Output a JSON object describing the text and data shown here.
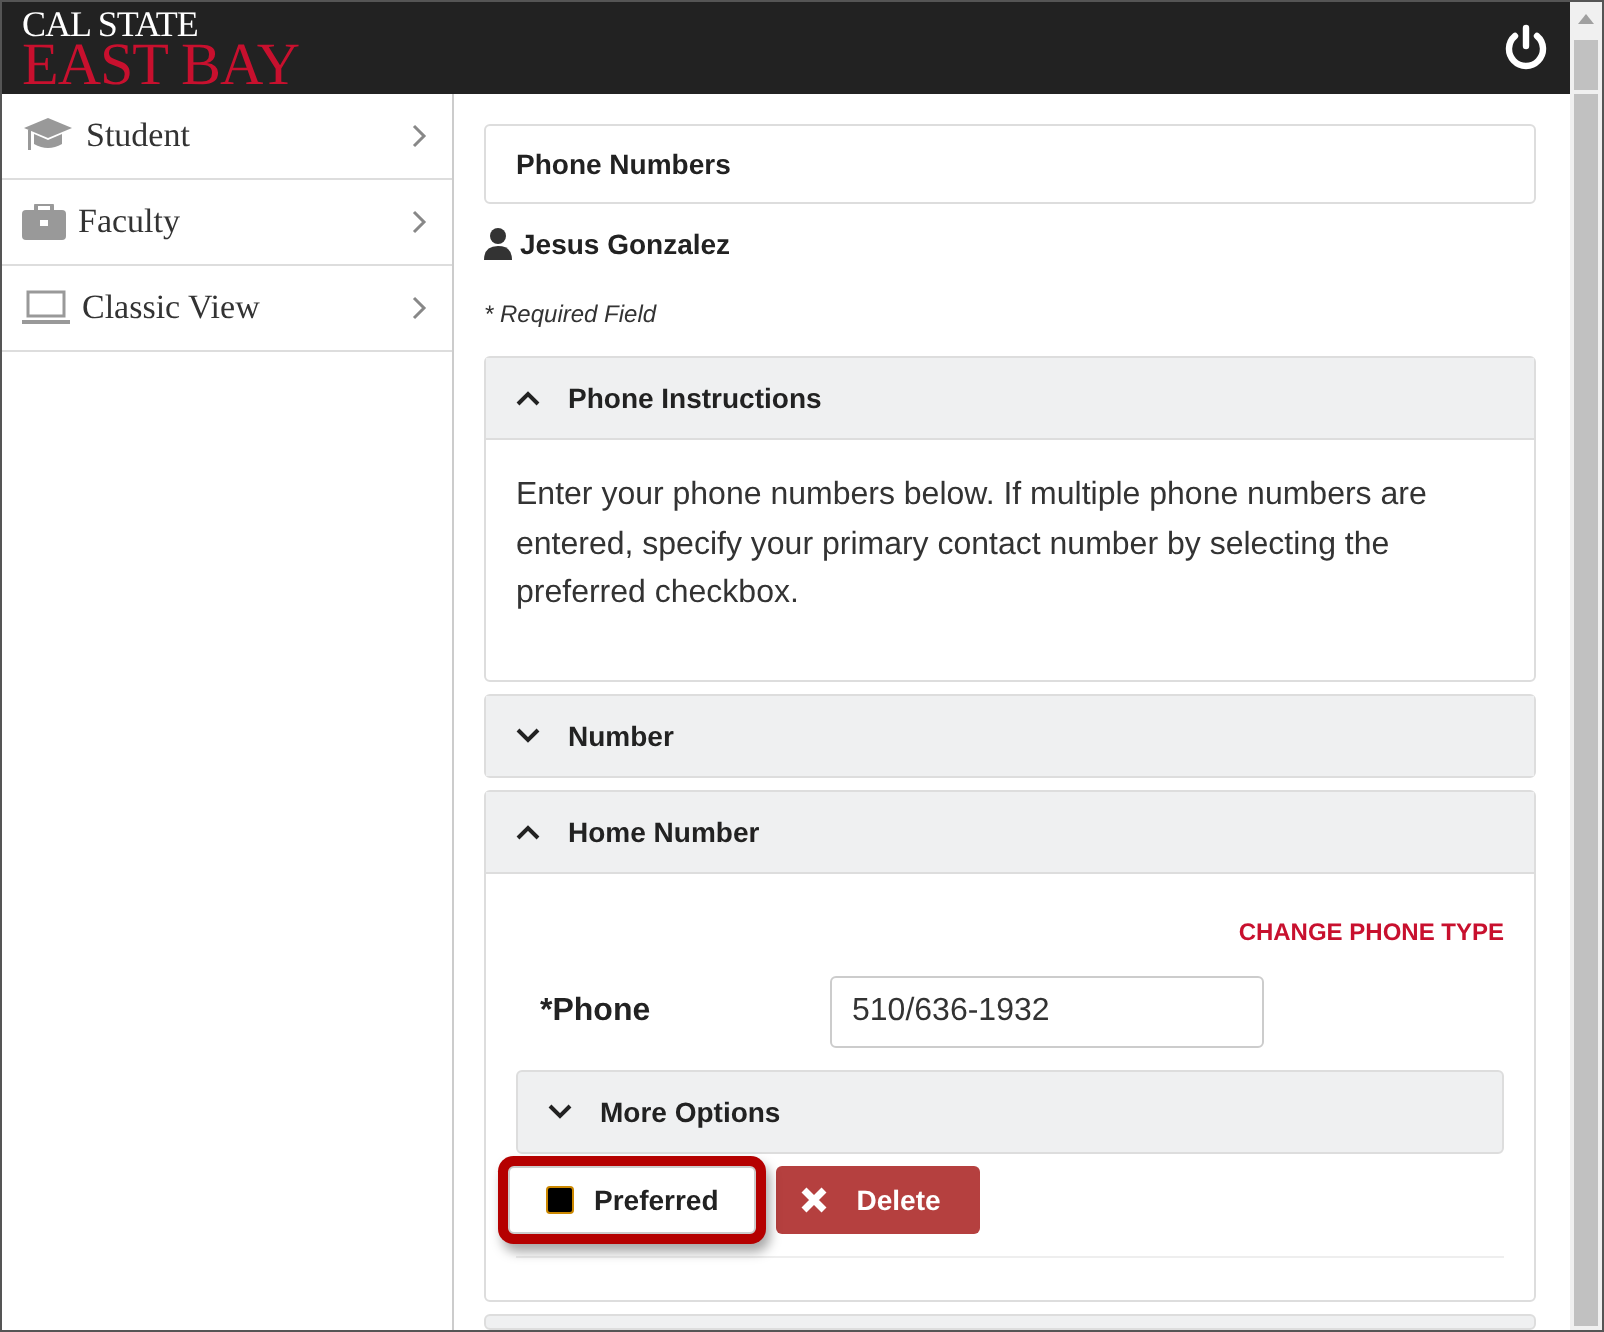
{
  "header": {
    "logo_top": "CAL STATE",
    "logo_bottom": "EAST BAY"
  },
  "sidebar": {
    "items": [
      {
        "label": "Student"
      },
      {
        "label": "Faculty"
      },
      {
        "label": "Classic View"
      }
    ]
  },
  "page_title": "Phone Numbers",
  "user_name": "Jesus Gonzalez",
  "required_note": "* Required Field",
  "sections": [
    {
      "kind": "text",
      "title": "Phone Instructions",
      "expanded": true,
      "body": "Enter your phone numbers below. If multiple phone numbers are entered, specify your primary contact number by selecting the preferred checkbox."
    },
    {
      "title": "Number",
      "expanded": false
    },
    {
      "kind": "phone",
      "title": "Home Number",
      "expanded": true,
      "change_link": "CHANGE PHONE TYPE",
      "field_label": "*Phone",
      "value": "510/636-1932",
      "more_options": {
        "title": "More Options",
        "expanded": false
      },
      "preferred": {
        "label": "Preferred",
        "checked": true,
        "highlighted": true
      },
      "delete_label": "Delete"
    }
  ]
}
